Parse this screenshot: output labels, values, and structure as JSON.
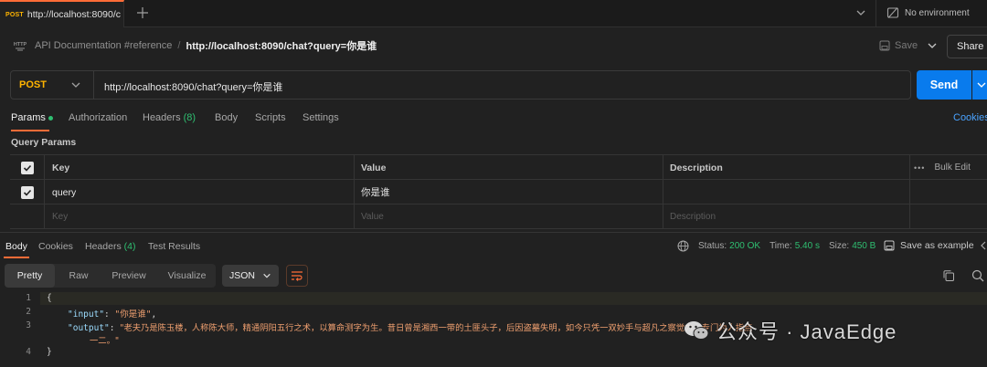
{
  "tabbar": {
    "active_tab": {
      "method": "POST",
      "url": "http://localhost:8090/c"
    },
    "environment": "No environment"
  },
  "breadcrumb": {
    "collection": "API Documentation #reference",
    "separator": "/",
    "request": "http://localhost:8090/chat?query=你是谁"
  },
  "actions": {
    "save_label": "Save",
    "share_label": "Share"
  },
  "request": {
    "method": "POST",
    "url": "http://localhost:8090/chat?query=你是谁",
    "send_label": "Send"
  },
  "request_tabs": {
    "params": "Params",
    "authorization": "Authorization",
    "headers": "Headers",
    "headers_count": "(8)",
    "body": "Body",
    "scripts": "Scripts",
    "settings": "Settings",
    "cookies": "Cookies"
  },
  "query_params": {
    "title": "Query Params",
    "headers": {
      "key": "Key",
      "value": "Value",
      "description": "Description",
      "bulk_edit": "Bulk Edit",
      "more": "•••"
    },
    "rows": [
      {
        "checked": true,
        "key": "query",
        "value": "你是谁",
        "description": ""
      }
    ],
    "placeholder": {
      "key": "Key",
      "value": "Value",
      "description": "Description"
    }
  },
  "response_tabs": {
    "body": "Body",
    "cookies": "Cookies",
    "headers": "Headers",
    "headers_count": "(4)",
    "test_results": "Test Results"
  },
  "response_meta": {
    "status_label": "Status:",
    "status_value": "200 OK",
    "time_label": "Time:",
    "time_value": "5.40 s",
    "size_label": "Size:",
    "size_value": "450 B",
    "save_example": "Save as example"
  },
  "viewer": {
    "modes": [
      "Pretty",
      "Raw",
      "Preview",
      "Visualize"
    ],
    "active_mode": "Pretty",
    "format": "JSON"
  },
  "code": {
    "line_numbers": [
      "1",
      "2",
      "3",
      "",
      "4"
    ],
    "line1": "{",
    "input_key": "\"input\"",
    "input_value": "\"你是谁\"",
    "output_key": "\"output\"",
    "output_value_a": "\"老夫乃是陈玉楼，人称陈大师，精通阴阳五行之术，以算命测字为生。昔日曾是湘西一带的土匪头子，后因盗墓失明，如今只凭一双妙手与超凡之察觉力，专门为人指点",
    "output_value_b": "一二。\"",
    "line4": "}",
    "colon": ": ",
    "comma": ","
  },
  "watermark": {
    "text": "公众号 · JavaEdge"
  },
  "colors": {
    "accent": "#ff6c37",
    "method": "#ffb400",
    "send": "#097bed",
    "success": "#2fbf71",
    "link": "#4aa3ff"
  }
}
